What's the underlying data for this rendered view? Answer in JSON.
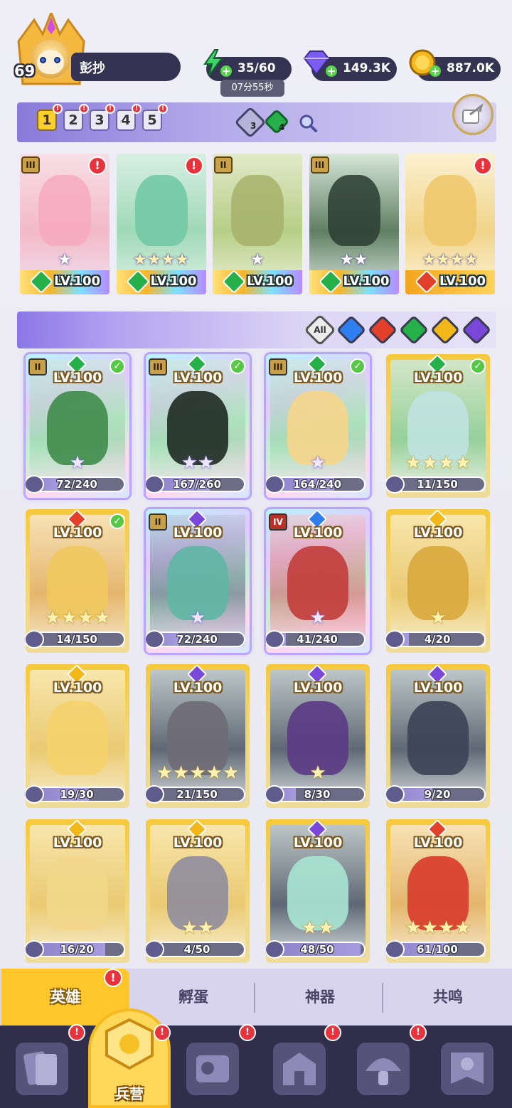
{
  "player": {
    "level": "69",
    "name": "彭抄"
  },
  "resources": {
    "energy": {
      "value": "35/60",
      "timer": "07分55秒",
      "icon": "lightning-icon",
      "color": "#3fd16a"
    },
    "gems": {
      "value": "149.3K",
      "icon": "gem-icon",
      "color": "#7b5cf0"
    },
    "gold": {
      "value": "887.0K",
      "icon": "coin-icon",
      "color": "#f4b81d"
    }
  },
  "team_tabs": [
    "1",
    "2",
    "3",
    "4",
    "5"
  ],
  "team_chips": [
    {
      "count": "3",
      "icon": "water-gem-icon"
    },
    {
      "count": "4",
      "icon": "nature-gem-icon"
    }
  ],
  "team": [
    {
      "level": "LV.100",
      "rank": "III",
      "element": "nature",
      "stars": 1
    },
    {
      "level": "LV.100",
      "rank": "",
      "element": "nature",
      "stars": 4
    },
    {
      "level": "LV.100",
      "rank": "II",
      "element": "nature",
      "stars": 1
    },
    {
      "level": "LV.100",
      "rank": "III",
      "element": "nature",
      "stars": 2
    },
    {
      "level": "LV.100",
      "rank": "",
      "element": "fire",
      "stars": 4
    }
  ],
  "filters": {
    "all_label": "All",
    "elements": [
      "water",
      "fire",
      "nature",
      "light",
      "dark"
    ]
  },
  "heroes": [
    {
      "level": "LV.100",
      "rank": "II",
      "element": "nature",
      "fragments": "72/240",
      "progress": 0.3,
      "stars": 1,
      "star_color": "purple",
      "checked": true,
      "owned": true
    },
    {
      "level": "LV.100",
      "rank": "III",
      "element": "nature",
      "fragments": "167/260",
      "progress": 0.64,
      "stars": 2,
      "star_color": "purple",
      "checked": true,
      "owned": true
    },
    {
      "level": "LV.100",
      "rank": "III",
      "element": "nature",
      "fragments": "164/240",
      "progress": 0.68,
      "stars": 1,
      "star_color": "purple",
      "checked": true,
      "owned": true
    },
    {
      "level": "LV.100",
      "rank": "",
      "element": "nature",
      "fragments": "11/150",
      "progress": 0.07,
      "stars": 4,
      "star_color": "gold",
      "checked": true,
      "owned": false
    },
    {
      "level": "LV.100",
      "rank": "",
      "element": "fire",
      "fragments": "14/150",
      "progress": 0.09,
      "stars": 4,
      "star_color": "gold",
      "checked": true,
      "owned": false
    },
    {
      "level": "LV.100",
      "rank": "II",
      "element": "dark",
      "fragments": "72/240",
      "progress": 0.3,
      "stars": 1,
      "star_color": "purple",
      "checked": false,
      "owned": true
    },
    {
      "level": "LV.100",
      "rank": "IV",
      "element": "water",
      "fragments": "41/240",
      "progress": 0.17,
      "stars": 1,
      "star_color": "purple",
      "checked": false,
      "owned": true
    },
    {
      "level": "LV.100",
      "rank": "",
      "element": "light",
      "fragments": "4/20",
      "progress": 0.2,
      "stars": 1,
      "star_color": "gold",
      "checked": false,
      "owned": false
    },
    {
      "level": "LV.100",
      "rank": "",
      "element": "light",
      "fragments": "19/30",
      "progress": 0.63,
      "stars": 0,
      "star_color": "gold",
      "checked": false,
      "owned": false
    },
    {
      "level": "LV.100",
      "rank": "",
      "element": "dark",
      "fragments": "21/150",
      "progress": 0.14,
      "stars": 5,
      "star_color": "gold",
      "checked": false,
      "owned": false
    },
    {
      "level": "LV.100",
      "rank": "",
      "element": "dark",
      "fragments": "8/30",
      "progress": 0.27,
      "stars": 1,
      "star_color": "gold",
      "checked": false,
      "owned": false
    },
    {
      "level": "LV.100",
      "rank": "",
      "element": "dark",
      "fragments": "9/20",
      "progress": 0.45,
      "stars": 0,
      "star_color": "gold",
      "checked": false,
      "owned": false
    },
    {
      "level": "LV.100",
      "rank": "",
      "element": "light",
      "fragments": "16/20",
      "progress": 0.8,
      "stars": 0,
      "star_color": "gold",
      "checked": false,
      "owned": false
    },
    {
      "level": "LV.100",
      "rank": "",
      "element": "light",
      "fragments": "4/50",
      "progress": 0.08,
      "stars": 2,
      "star_color": "gold",
      "checked": false,
      "owned": false
    },
    {
      "level": "LV.100",
      "rank": "",
      "element": "dark",
      "fragments": "48/50",
      "progress": 0.96,
      "stars": 2,
      "star_color": "gold",
      "checked": false,
      "owned": false
    },
    {
      "level": "LV.100",
      "rank": "",
      "element": "fire",
      "fragments": "61/100",
      "progress": 0.61,
      "stars": 4,
      "star_color": "gold",
      "checked": false,
      "owned": false
    }
  ],
  "subtabs": [
    "英雄",
    "孵蛋",
    "神器",
    "共鸣"
  ],
  "nav": {
    "center_label": "兵营"
  },
  "element_colors": {
    "nature": "#25b04a",
    "fire": "#e2402a",
    "water": "#2f7ef0",
    "light": "#f2b81a",
    "dark": "#7a48d8"
  }
}
